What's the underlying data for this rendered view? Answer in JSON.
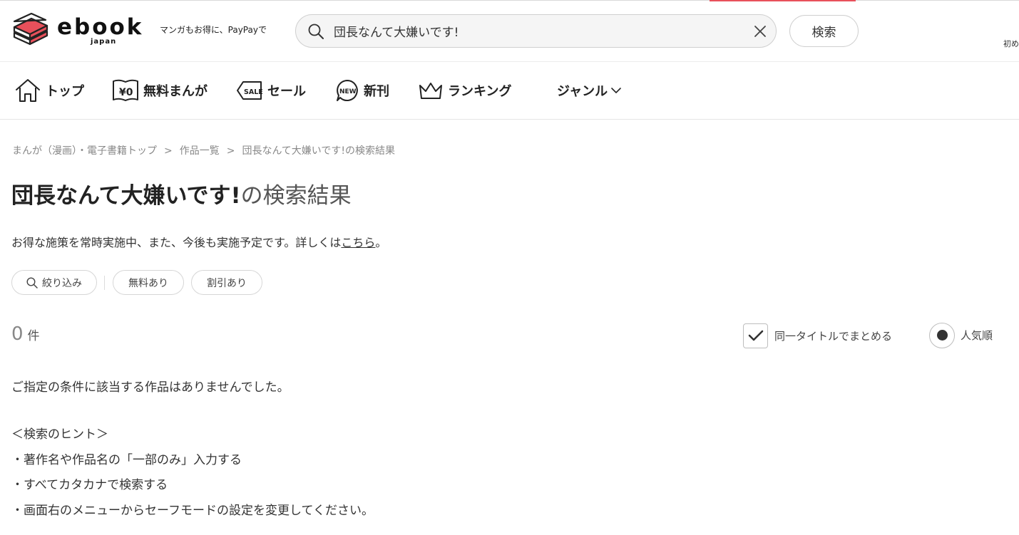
{
  "header": {
    "logo_text": "ebook",
    "logo_subtext": "japan",
    "tagline": "マンガもお得に、PayPayで",
    "search": {
      "value": "団長なんて大嫌いです!",
      "placeholder": "",
      "button_label": "検索"
    },
    "right_text": "初め"
  },
  "nav": {
    "items": [
      {
        "label": "トップ",
        "icon": "home-icon"
      },
      {
        "label": "無料まんが",
        "icon": "free-manga-icon"
      },
      {
        "label": "セール",
        "icon": "sale-tag-icon"
      },
      {
        "label": "新刊",
        "icon": "new-badge-icon"
      },
      {
        "label": "ランキング",
        "icon": "crown-icon"
      },
      {
        "label": "ジャンル",
        "icon": "chevron-down-icon"
      }
    ]
  },
  "breadcrumb": {
    "items": [
      "まんが（漫画）・電子書籍トップ",
      "作品一覧",
      "団長なんて大嫌いです!の検索結果"
    ],
    "separator": ">"
  },
  "page": {
    "title_query": "団長なんて大嫌いです!",
    "title_suffix": "の検索結果",
    "notice_text": "お得な施策を常時実施中、また、今後も実施予定です。詳しくは",
    "notice_link": "こちら",
    "notice_end": "。"
  },
  "filters": {
    "refine_label": "絞り込み",
    "free_label": "無料あり",
    "discount_label": "割引あり"
  },
  "results": {
    "count": "0",
    "count_unit": "件",
    "group_label": "同一タイトルでまとめる",
    "group_checked": true,
    "sort_label": "人気順",
    "sort_selected": true,
    "no_result_message": "ご指定の条件に該当する作品はありませんでした。"
  },
  "hints": {
    "heading": "＜検索のヒント＞",
    "items": [
      "・著作名や作品名の「一部のみ」入力する",
      "・すべてカタカナで検索する",
      "・画面右のメニューからセーフモードの設定を変更してください。"
    ]
  },
  "colors": {
    "brand_red": "#e8505b",
    "text": "#333333",
    "muted": "#888888",
    "border": "#d6d6d6"
  }
}
